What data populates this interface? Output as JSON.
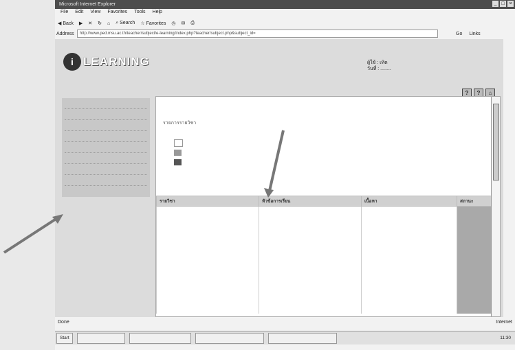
{
  "titlebar": {
    "title": "Microsoft Internet Explorer"
  },
  "menu": [
    "File",
    "Edit",
    "View",
    "Favorites",
    "Tools",
    "Help"
  ],
  "toolbar": {
    "back": "Back",
    "search": "Search",
    "favorites": "Favorites"
  },
  "address": {
    "label": "Address",
    "url": "http://www.ped.msu.ac.th/teacher/subject/e-learning/index.php?teacher/subject.php&subject_id=",
    "go": "Go",
    "links": "Links"
  },
  "logo": {
    "text": "LEARNING"
  },
  "user": {
    "line1": "ผู้ใช้ : เทิด",
    "line2": "วันที่ : ........"
  },
  "content": {
    "subtitle": "รายการรายวิชา"
  },
  "columns": [
    "รายวิชา",
    "หัวข้อการเรียน",
    "เนื้อหา",
    "สถานะ"
  ],
  "statusbar": {
    "left": "Done",
    "right": "Internet"
  },
  "taskbar": {
    "start": "Start",
    "clock": "11:30"
  }
}
